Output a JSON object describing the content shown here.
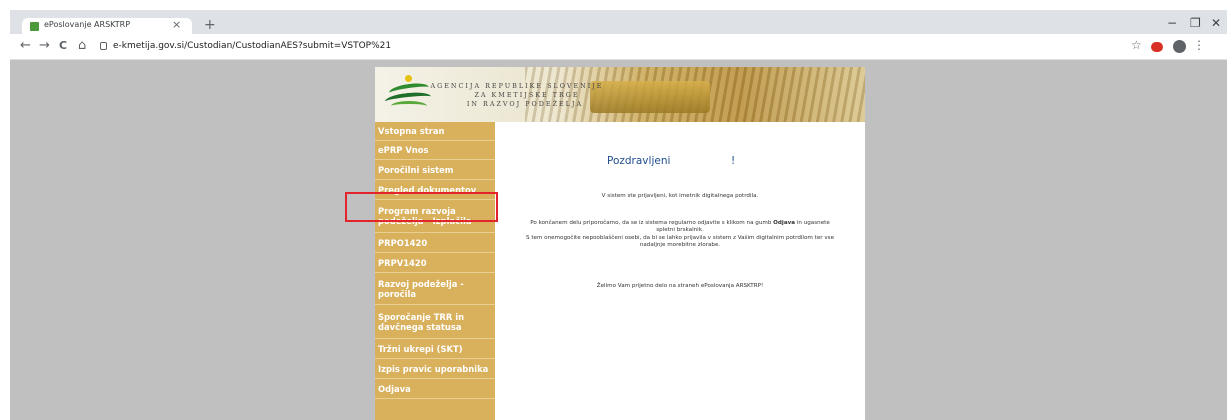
{
  "browser": {
    "tab_title": "ePoslovanje ARSKTRP",
    "tab_close": "×",
    "new_tab": "+",
    "window_controls": {
      "minimize": "−",
      "restore": "❐",
      "close": "✕"
    },
    "nav": {
      "back": "←",
      "forward": "→",
      "reload": "C",
      "home": "⌂"
    },
    "url": "e-kmetija.gov.si/Custodian/CustodianAES?submit=VSTOP%21",
    "bookmark_icon": "☆",
    "menu_icon": "⋮"
  },
  "banner": {
    "line1": "AGENCIJA REPUBLIKE SLOVENIJE",
    "line2": "ZA KMETIJSKE TRGE",
    "line3": "IN RAZVOJ PODEŽELJA"
  },
  "sidebar": {
    "items": [
      {
        "label": "Vstopna stran"
      },
      {
        "label": "ePRP Vnos"
      },
      {
        "label": "Poročilni sistem"
      },
      {
        "label": "Pregled dokumentov"
      },
      {
        "label": "Program razvoja podeželja - Izplačila"
      },
      {
        "label": "PRPO1420"
      },
      {
        "label": "PRPV1420"
      },
      {
        "label": "Razvoj podeželja - poročila"
      },
      {
        "label": "Sporočanje TRR in davčnega statusa"
      },
      {
        "label": "Tržni ukrepi (SKT)"
      },
      {
        "label": "Izpis pravic uporabnika"
      },
      {
        "label": "Odjava"
      }
    ]
  },
  "content": {
    "greeting": "Pozdravljeni",
    "greeting_end": "!",
    "login_info": "V sistem ste prijavljeni, kot imetnik digitalnega potrdila.",
    "advice_1": "Po končanem delu priporočamo, da se iz sistema regularno odjavite s klikom na gumb",
    "advice_bold": "Odjava",
    "advice_2": "in ugasnete spletni brskalnik.",
    "advice_3": "S tem onemogočite nepooblaščeni osebi, da bi se lahko prijavila v sistem z Vašim digitalnim potrdilom ter vse nadaljnje morebitne zlorabe.",
    "closing": "Želimo Vam prijetno delo na straneh ePoslovanja ARSKTRP!"
  },
  "colors": {
    "sidebar_bg": "#d9b05c",
    "greeting": "#1f4e8c",
    "highlight": "#e3242b"
  }
}
